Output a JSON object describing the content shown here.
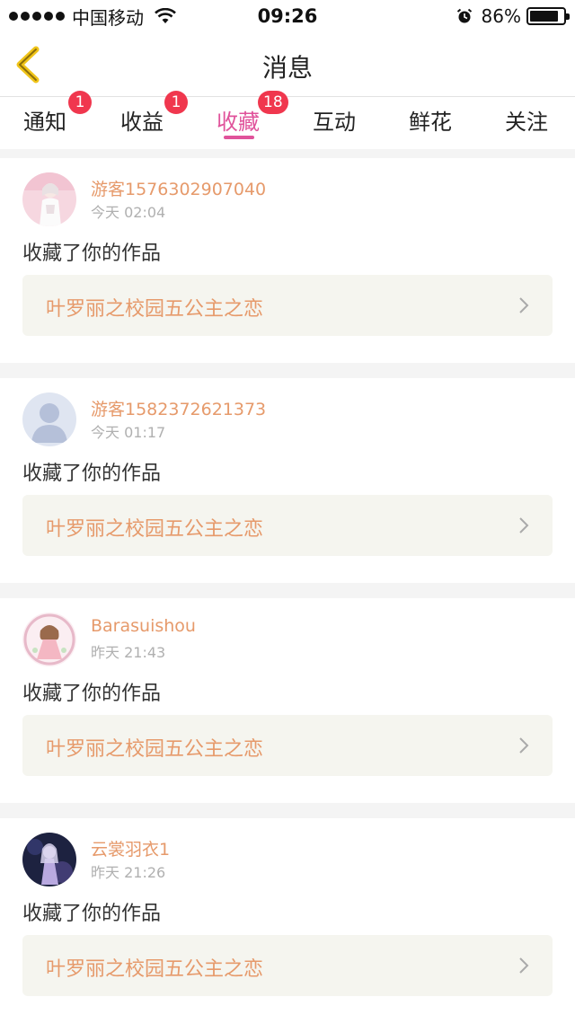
{
  "status_bar": {
    "carrier": "中国移动",
    "time": "09:26",
    "battery": "86%",
    "battery_level": 0.86
  },
  "header": {
    "title": "消息"
  },
  "tabs": [
    {
      "label": "通知",
      "badge": "1"
    },
    {
      "label": "收益",
      "badge": "1"
    },
    {
      "label": "收藏",
      "badge": "18",
      "active": true
    },
    {
      "label": "互动"
    },
    {
      "label": "鲜花"
    },
    {
      "label": "关注"
    }
  ],
  "feed": [
    {
      "username": "游客1576302907040",
      "time": "今天 02:04",
      "action": "收藏了你的作品",
      "work_title": "叶罗丽之校园五公主之恋"
    },
    {
      "username": "游客1582372621373",
      "time": "今天 01:17",
      "action": "收藏了你的作品",
      "work_title": "叶罗丽之校园五公主之恋"
    },
    {
      "username": "Barasuishou",
      "time": "昨天 21:43",
      "action": "收藏了你的作品",
      "work_title": "叶罗丽之校园五公主之恋"
    },
    {
      "username": "云裳羽衣1",
      "time": "昨天 21:26",
      "action": "收藏了你的作品",
      "work_title": "叶罗丽之校园五公主之恋"
    }
  ],
  "colors": {
    "accent": "#e0539b",
    "badge": "#f0374e",
    "username": "#e69a6b",
    "back_arrow": "#f0c419"
  }
}
